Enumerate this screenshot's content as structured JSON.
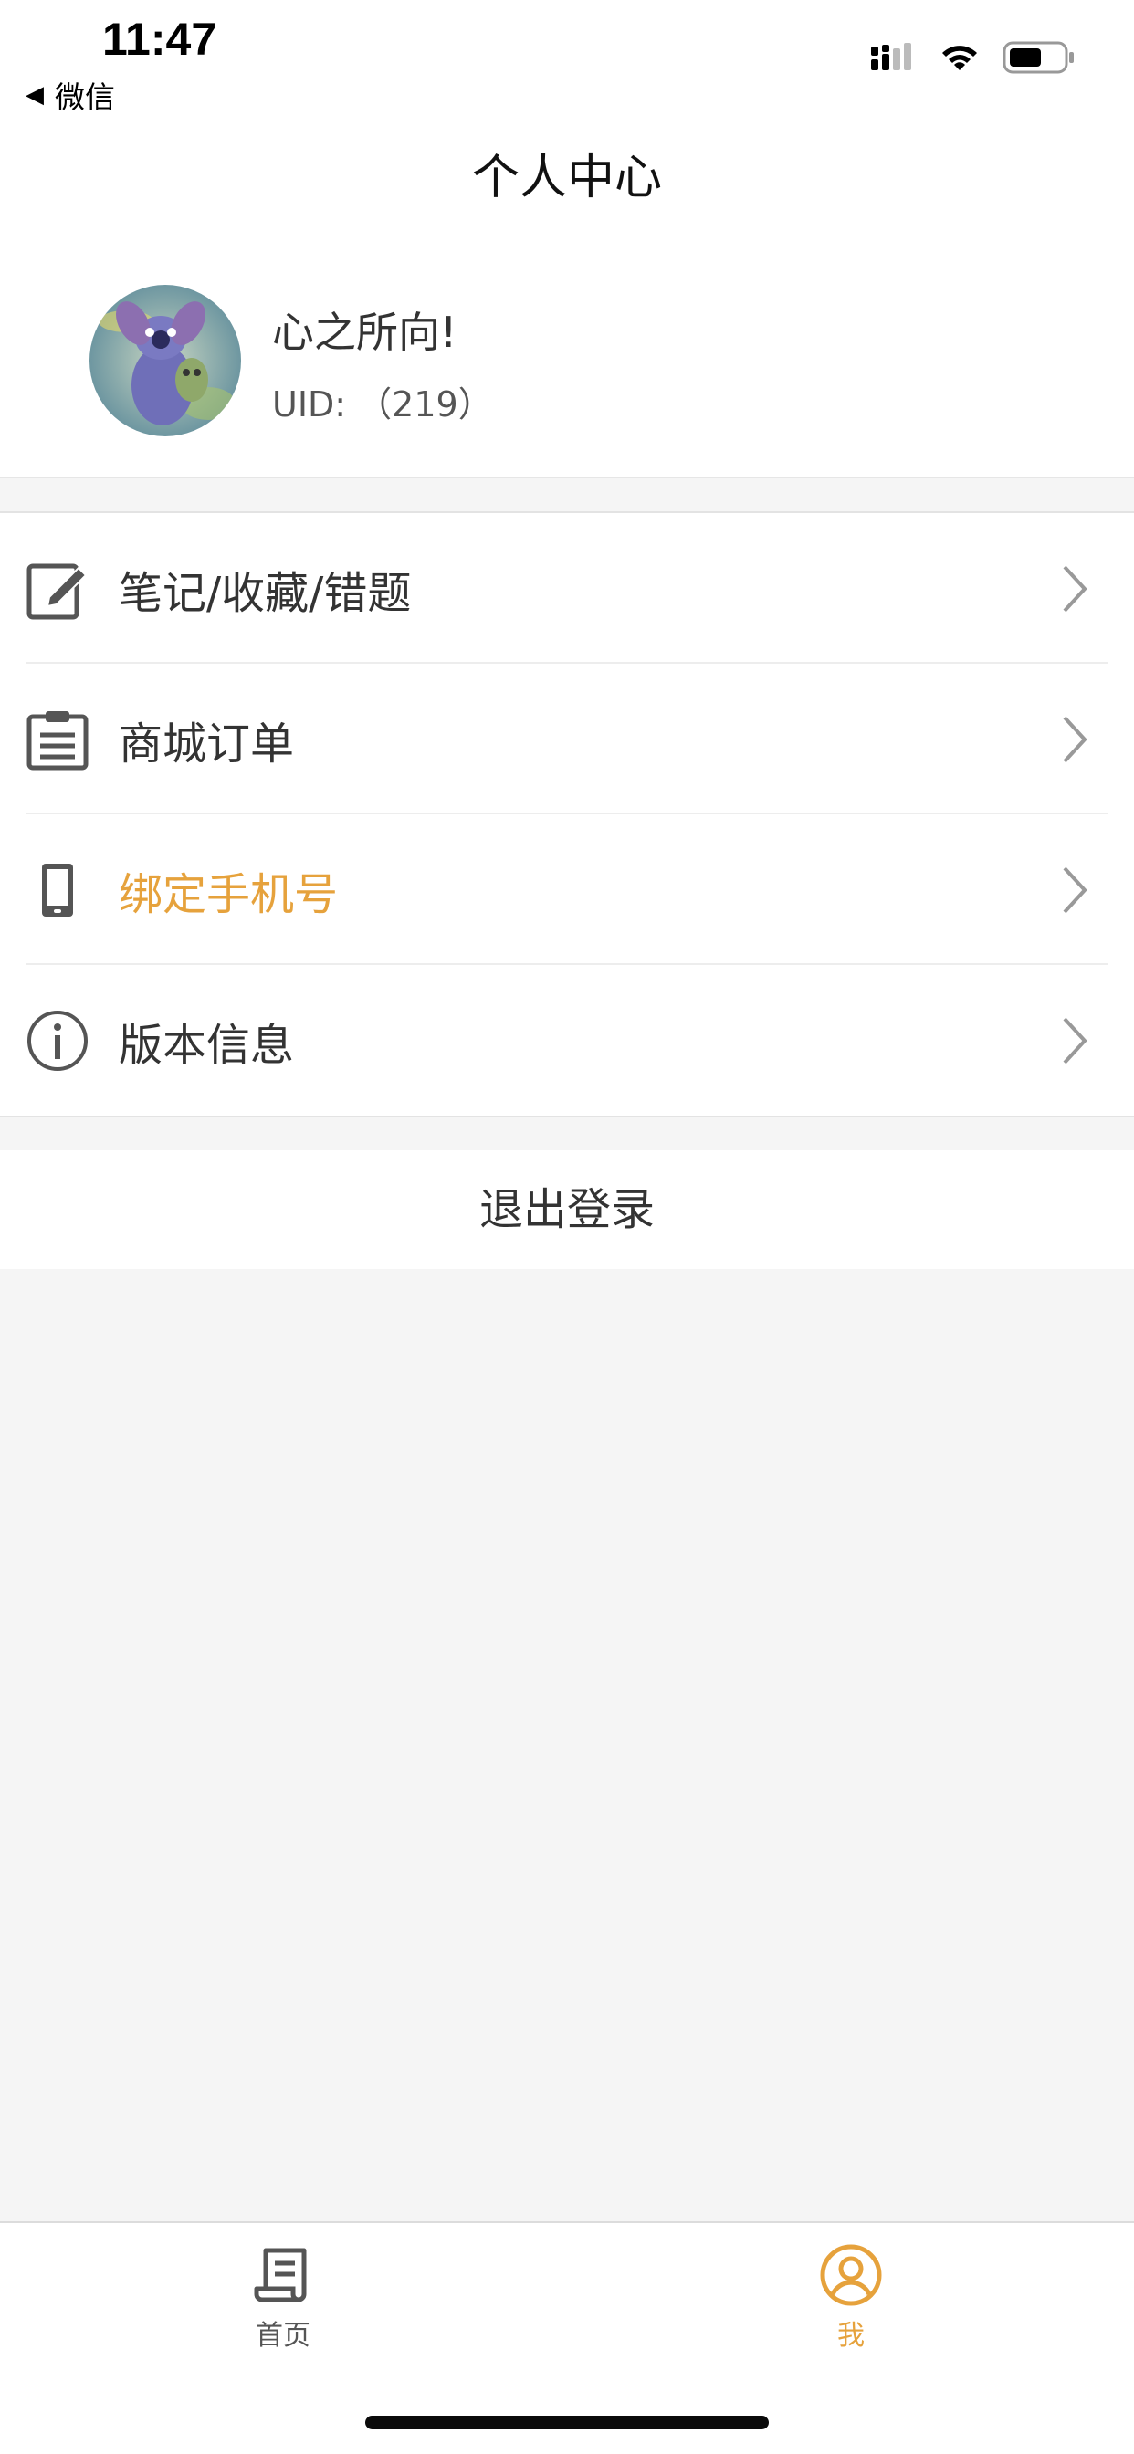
{
  "status_bar": {
    "time": "11:47",
    "back_label": "微信",
    "back_arrow": "◀"
  },
  "header": {
    "title": "个人中心"
  },
  "profile": {
    "nickname": "心之所向!",
    "uid": "UID: （219）"
  },
  "menu": {
    "items": [
      {
        "label": "笔记/收藏/错题",
        "icon": "edit-icon"
      },
      {
        "label": "商城订单",
        "icon": "clipboard-icon"
      },
      {
        "label": "绑定手机号",
        "icon": "phone-icon",
        "highlight": true
      },
      {
        "label": "版本信息",
        "icon": "info-icon"
      }
    ]
  },
  "logout": {
    "label": "退出登录"
  },
  "tabbar": {
    "tabs": [
      {
        "label": "首页",
        "icon": "document-icon",
        "active": false
      },
      {
        "label": "我",
        "icon": "user-circle-icon",
        "active": true
      }
    ]
  },
  "colors": {
    "accent": "#e6a23c",
    "background": "#f5f5f5",
    "text": "#333333"
  }
}
